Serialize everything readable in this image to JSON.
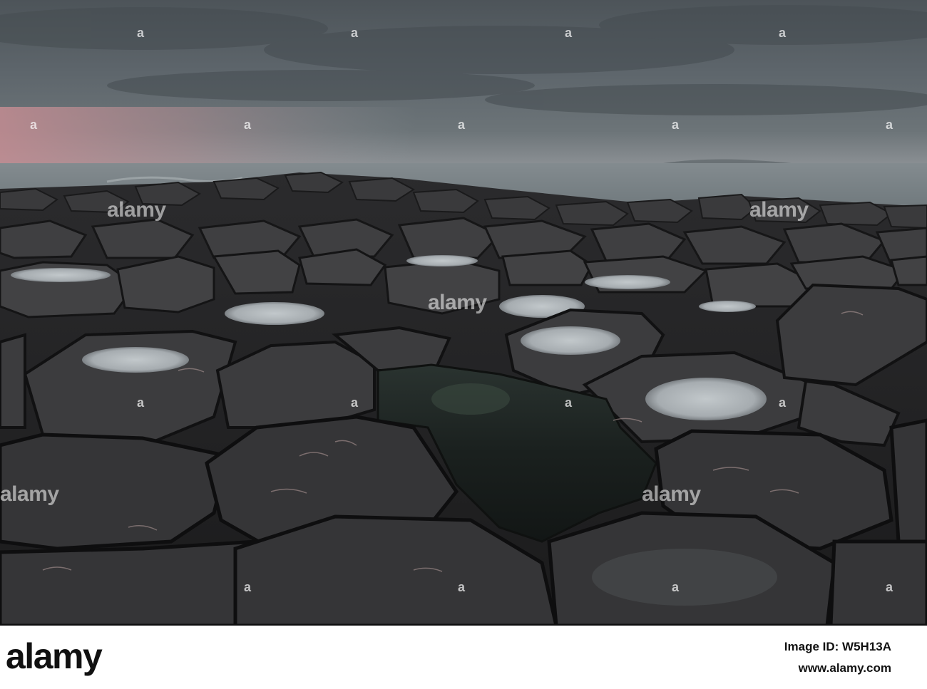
{
  "watermark": {
    "text": "alamy",
    "marks": "a"
  },
  "footer": {
    "logo": "alamy",
    "image_id_label": "Image ID: W5H13A",
    "url": "www.alamy.com"
  },
  "colors": {
    "sky": "#5f666c",
    "sea": "#7d868a",
    "rock": "#3b3b3d",
    "pool": "#1c2220",
    "footer_bg": "#ffffff"
  }
}
